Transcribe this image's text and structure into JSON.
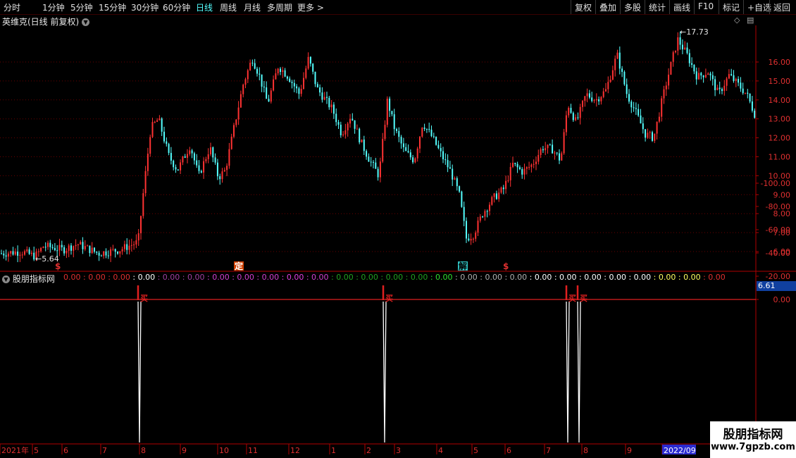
{
  "toolbar": {
    "periods": [
      "分时",
      "1分钟",
      "5分钟",
      "15分钟",
      "30分钟",
      "60分钟",
      "日线",
      "周线",
      "月线",
      "多周期",
      "更多 >"
    ],
    "active_period": "日线",
    "right": [
      "复权",
      "叠加",
      "多股",
      "统计",
      "画线",
      "F10",
      "标记",
      "+自选",
      "返回"
    ]
  },
  "chart": {
    "title": "英维克(日线 前复权)",
    "y_ticks": [
      "16.00",
      "15.00",
      "14.00",
      "13.00",
      "12.00",
      "11.00",
      "10.00",
      "9.00",
      "8.00",
      "7.00",
      "6.00"
    ],
    "high_label": "17.73",
    "low_label": "5.64",
    "markers": [
      {
        "text": "$",
        "type": "s"
      },
      {
        "text": "定",
        "type": "ding"
      },
      {
        "text": "解",
        "type": "jie"
      },
      {
        "text": "$",
        "type": "s"
      }
    ]
  },
  "indicator": {
    "title": "股朋指标网",
    "values": [
      "0.00",
      "0.00",
      "0.00",
      "0.00",
      "0.00",
      "0.00",
      "0.00",
      "0.00",
      "0.00",
      "0.00",
      "0.00",
      "0.00",
      "0.00",
      "0.00",
      "0.00",
      "0.00",
      "0.00",
      "0.00",
      "0.00",
      "0.00",
      "0.00",
      "0.00",
      "0.00",
      "0.00",
      "0.00",
      "0.00",
      "0.00"
    ],
    "value_colors": [
      "#e03030",
      "#e03030",
      "#e03030",
      "#ffffff",
      "#a040a0",
      "#a040a0",
      "#d040d0",
      "#d040d0",
      "#d040d0",
      "#e040e0",
      "#d040d0",
      "#20a020",
      "#20a020",
      "#20a020",
      "#20a020",
      "#30e030",
      "#b0b0b0",
      "#b0b0b0",
      "#b0b0b0",
      "#ffffff",
      "#ffffff",
      "#ffffff",
      "#ffffff",
      "#ffffff",
      "#ffff60",
      "#ffff60",
      "#e03030"
    ],
    "y_ticks": [
      "0.00",
      "-20.00",
      "-40.00",
      "-60.00",
      "-80.00",
      "-100.00"
    ],
    "signal_label": "买",
    "badge": "6.61"
  },
  "xaxis": {
    "labels": [
      "2021年",
      "5",
      "6",
      "7",
      "8",
      "9",
      "10",
      "11",
      "12",
      "1",
      "2",
      "3",
      "4",
      "5",
      "6",
      "7",
      "8",
      "9",
      "2022/09"
    ]
  },
  "watermark": {
    "line1": "股朋指标网",
    "line2": "www.7gpzb.com"
  },
  "colors": {
    "up": "#ff3232",
    "down": "#54ffff",
    "axis": "#b00000",
    "grid": "#6a0000"
  }
}
